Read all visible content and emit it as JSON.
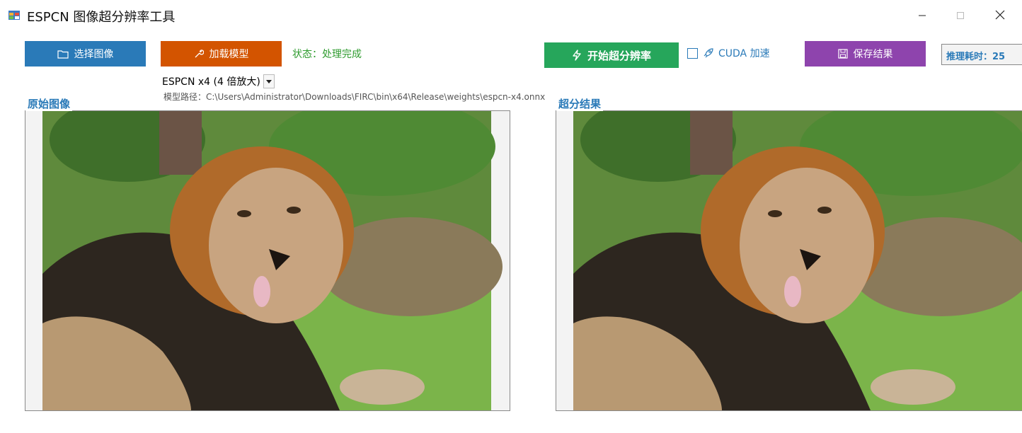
{
  "window": {
    "title": "ESPCN 图像超分辨率工具",
    "icon": "app-window-icon",
    "controls": [
      "minimize-icon",
      "maximize-icon",
      "close-icon"
    ]
  },
  "toolbar": {
    "select_image_label": "选择图像",
    "load_model_label": "加载模型",
    "status_text": "状态：处理完成",
    "start_label": "开始超分辨率",
    "cuda_label": "CUDA 加速",
    "cuda_checked": false,
    "save_label": "保存结果",
    "timing_text": "推理耗时：25"
  },
  "model": {
    "selected": "ESPCN x4 (4 倍放大)",
    "path_text": "模型路径：C:\\Users\\Administrator\\Downloads\\FIRC\\bin\\x64\\Release\\weights\\espcn-x4.onnx"
  },
  "panels": {
    "original_label": "原始图像",
    "result_label": "超分结果",
    "image_subject": "lion lying on grass"
  },
  "colors": {
    "select_button": "#2a7ab8",
    "load_button": "#d35400",
    "start_button": "#26a65b",
    "save_button": "#8e44ad",
    "status_text": "#2e9b2e",
    "group_label": "#2a7ab8"
  }
}
